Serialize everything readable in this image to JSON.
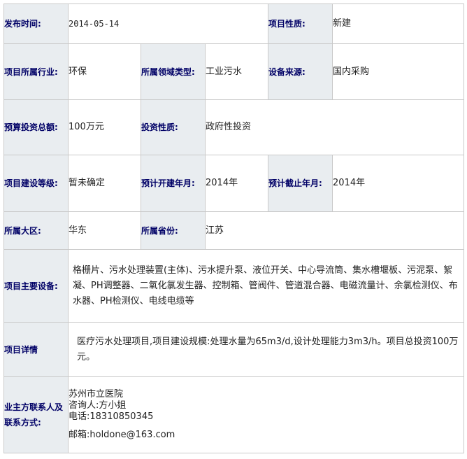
{
  "rows": {
    "publish_time": {
      "label": "发布时间:",
      "value": "2014-05-14"
    },
    "project_nature": {
      "label": "项目性质:",
      "value": "新建"
    },
    "industry": {
      "label": "项目所属行业:",
      "value": "环保"
    },
    "field_type": {
      "label": "所属领域类型:",
      "value": "工业污水"
    },
    "equipment_source": {
      "label": "设备来源:",
      "value": "国内采购"
    },
    "budget": {
      "label": "预算投资总额:",
      "value": "100万元"
    },
    "investment_nature": {
      "label": "投资性质:",
      "value": "政府性投资"
    },
    "construction_level": {
      "label": "项目建设等级:",
      "value": "暂未确定"
    },
    "planned_start": {
      "label": "预计开建年月:",
      "value": "2014年"
    },
    "planned_end": {
      "label": "预计截止年月:",
      "value": "2014年"
    },
    "region": {
      "label": "所属大区:",
      "value": "华东"
    },
    "province": {
      "label": "所属省份:",
      "value": "江苏"
    },
    "main_equipment": {
      "label": "项目主要设备:",
      "value": "格栅片、污水处理装置(主体)、污水提升泵、液位开关、中心导流筒、集水槽堰板、污泥泵、絮凝、PH调整器、二氧化氯发生器、控制箱、管阀件、管道混合器、电磁流量计、余氯检测仪、布水器、PH检测仪、电线电缆等"
    },
    "details": {
      "label": "项目详情",
      "value": "医疗污水处理项目,项目建设规模:处理水量为65m3/d,设计处理能力3m3/h。项目总投资100万元。"
    },
    "contact": {
      "label": "业主方联系人及联系方式:",
      "org": "苏州市立医院",
      "person": "咨询人:方小姐",
      "phone": "电话:18310850345",
      "email": "邮箱:holdone@163.com"
    }
  }
}
